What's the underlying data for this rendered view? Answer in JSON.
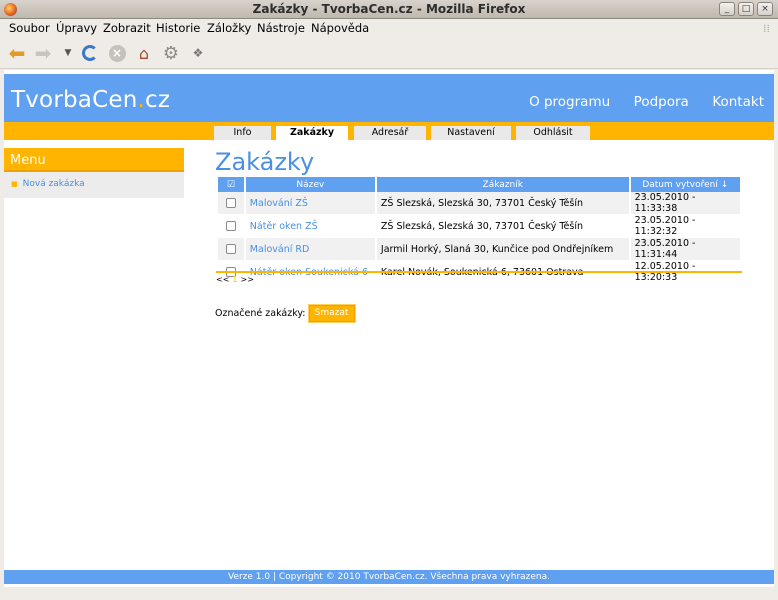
{
  "window": {
    "title": "Zakázky - TvorbaCen.cz - Mozilla Firefox"
  },
  "menubar": {
    "items": [
      "Soubor",
      "Úpravy",
      "Zobrazit",
      "Historie",
      "Záložky",
      "Nástroje",
      "Nápověda"
    ]
  },
  "toolbar": {
    "icons": [
      "back-arrow-icon",
      "forward-arrow-icon",
      "history-dropdown-icon",
      "reload-icon",
      "stop-icon",
      "home-icon",
      "settings-gear-icon",
      "addon-icon"
    ]
  },
  "site": {
    "logo_main": "TvorbaCen",
    "logo_dot": ".",
    "logo_tld": "cz",
    "nav": [
      "O programu",
      "Podpora",
      "Kontakt"
    ],
    "tabs": [
      "Info",
      "Zakázky",
      "Adresář",
      "Nastavení",
      "Odhlásit"
    ],
    "active_tab": "Zakázky"
  },
  "sidebar": {
    "title": "Menu",
    "items": [
      "Nová zakázka"
    ]
  },
  "main": {
    "title": "Zakázky",
    "columns": [
      "☑",
      "Název",
      "Zákazník",
      "Datum vytvoření ↓"
    ],
    "rows": [
      {
        "name": "Malování ZŠ",
        "customer": "ZŠ Slezská, Slezská 30, 73701 Český Těšín",
        "date": "23.05.2010 - 11:33:38"
      },
      {
        "name": "Nátěr oken ZŠ",
        "customer": "ZŠ Slezská, Slezská 30, 73701 Český Těšín",
        "date": "23.05.2010 - 11:32:32"
      },
      {
        "name": "Malování RD",
        "customer": "Jarmil Horký, Slaná 30, Kunčice pod Ondřejníkem",
        "date": "23.05.2010 - 11:31:44"
      },
      {
        "name": "Nátěr oken Soukenická 6",
        "customer": "Karel Novák, Soukenická 6, 73601 Ostrava",
        "date": "12.05.2010 - 13:20:33"
      }
    ],
    "pagination": {
      "prev": "<<",
      "current": "1",
      "next": ">>"
    },
    "bulk_label": "Označené zakázky:",
    "delete_button": "Smazat"
  },
  "footer": {
    "text": "Verze 1.0 | Copyright © 2010 TvorbaCen.cz. Všechna prava vyhrazena."
  },
  "colors": {
    "brand_blue": "#60a0f0",
    "accent_orange": "#ffb400",
    "link_blue": "#4a90e2"
  }
}
